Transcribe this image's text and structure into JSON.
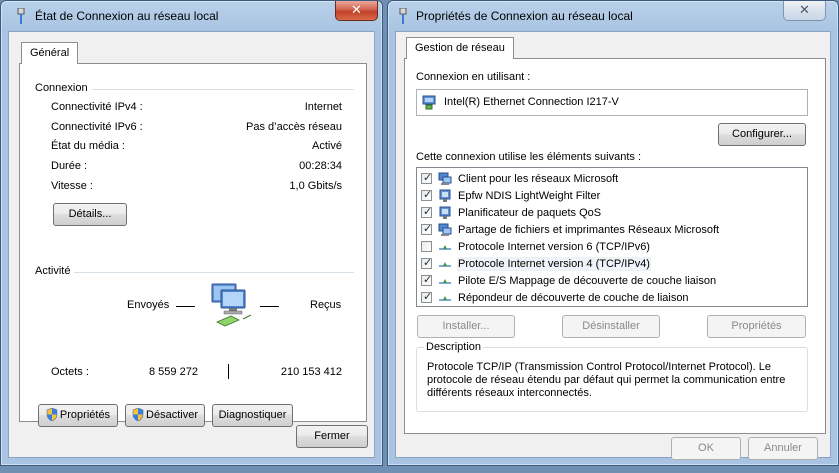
{
  "left_window": {
    "title": "État de Connexion au réseau local",
    "close_glyph": "✕",
    "tab": "Général",
    "connection": {
      "heading": "Connexion",
      "rows": [
        {
          "label": "Connectivité IPv4 :",
          "value": "Internet"
        },
        {
          "label": "Connectivité IPv6 :",
          "value": "Pas d’accès réseau"
        },
        {
          "label": "État du média :",
          "value": "Activé"
        },
        {
          "label": "Durée :",
          "value": "00:28:34"
        },
        {
          "label": "Vitesse :",
          "value": "1,0 Gbits/s"
        }
      ],
      "details_button": "Détails..."
    },
    "activity": {
      "heading": "Activité",
      "sent_label": "Envoyés",
      "received_label": "Reçus",
      "octets_label": "Octets :",
      "octets_sent": "8 559 272",
      "octets_received": "210 153 412"
    },
    "buttons": {
      "properties": "Propriétés",
      "disable": "Désactiver",
      "diagnose": "Diagnostiquer",
      "close": "Fermer"
    }
  },
  "right_window": {
    "title": "Propriétés de Connexion au réseau local",
    "close_glyph": "✕",
    "tab": "Gestion de réseau",
    "connect_using_label": "Connexion en utilisant :",
    "adapter_name": "Intel(R) Ethernet Connection I217-V",
    "configure_button": "Configurer...",
    "items_label": "Cette connexion utilise les éléments suivants :",
    "items": [
      {
        "label": "Client pour les réseaux Microsoft",
        "checked": true,
        "icon": "network-client-icon"
      },
      {
        "label": "Epfw NDIS LightWeight Filter",
        "checked": true,
        "icon": "network-service-icon"
      },
      {
        "label": "Planificateur de paquets QoS",
        "checked": true,
        "icon": "network-service-icon"
      },
      {
        "label": "Partage de fichiers et imprimantes Réseaux Microsoft",
        "checked": true,
        "icon": "network-client-icon"
      },
      {
        "label": "Protocole Internet version 6 (TCP/IPv6)",
        "checked": false,
        "icon": "protocol-icon"
      },
      {
        "label": "Protocole Internet version 4 (TCP/IPv4)",
        "checked": true,
        "icon": "protocol-icon"
      },
      {
        "label": "Pilote E/S Mappage de découverte de couche liaison",
        "checked": true,
        "icon": "protocol-icon"
      },
      {
        "label": "Répondeur de découverte de couche de liaison",
        "checked": true,
        "icon": "protocol-icon"
      }
    ],
    "install_button": "Installer...",
    "uninstall_button": "Désinstaller",
    "properties_button": "Propriétés",
    "description_heading": "Description",
    "description_text": "Protocole TCP/IP (Transmission Control Protocol/Internet Protocol). Le protocole de réseau étendu par défaut qui permet la communication entre différents réseaux interconnectés.",
    "ok_button": "OK",
    "cancel_button": "Annuler"
  },
  "colors": {
    "window_frame": "#a9c4e2",
    "close_red": "#c14129",
    "dialog_bg": "#f0f0f0"
  }
}
